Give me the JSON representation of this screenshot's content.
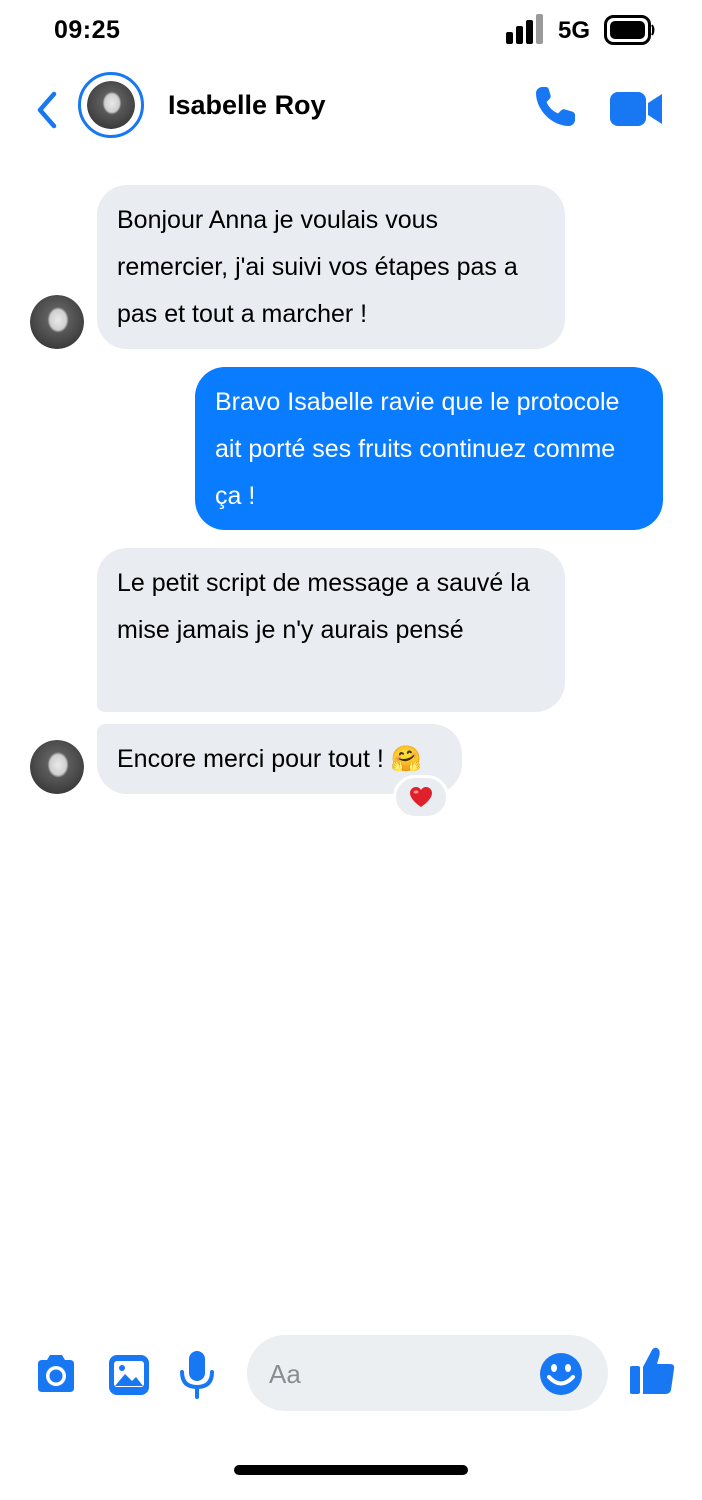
{
  "status_bar": {
    "time": "09:25",
    "network": "5G"
  },
  "header": {
    "contact_name": "Isabelle Roy",
    "back_icon": "chevron-left-icon",
    "call_icon": "phone-icon",
    "video_icon": "video-camera-icon",
    "accent_color": "#1877f2"
  },
  "messages": [
    {
      "direction": "incoming",
      "text": "Bonjour Anna je voulais vous remercier, j'ai suivi vos étapes pas a pas et tout a marcher !"
    },
    {
      "direction": "outgoing",
      "text": "Bravo Isabelle ravie que le protocole ait porté ses fruits continuez comme ça !"
    },
    {
      "direction": "incoming",
      "text": "Le petit script de message a sauvé la mise jamais je n'y aurais pensé"
    },
    {
      "direction": "incoming",
      "text": "Encore merci pour tout ! 🤗",
      "reaction": "❤️"
    }
  ],
  "composer": {
    "placeholder": "Aa",
    "icons": [
      "camera-icon",
      "image-icon",
      "microphone-icon",
      "emoji-icon",
      "thumbs-up-icon"
    ]
  },
  "colors": {
    "outgoing_bubble": "#0a7cff",
    "incoming_bubble": "#e9ecf0",
    "icon_blue": "#1877f2"
  }
}
